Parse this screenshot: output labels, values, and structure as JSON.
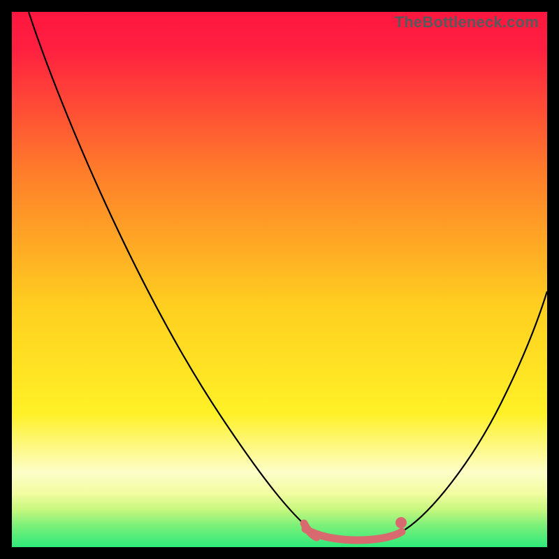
{
  "watermark": "TheBottleneck.com",
  "colors": {
    "red": "#ff163f",
    "orange": "#ff8f1a",
    "yellow": "#ffe821",
    "paleyellow": "#fdfec8",
    "green": "#2eea7a",
    "curve": "#000000",
    "marker_stroke": "#d86a6f",
    "marker_fill": "#d86a6f",
    "highlight_line": "#d86a6f"
  },
  "chart_data": {
    "type": "line",
    "title": "",
    "xlabel": "",
    "ylabel": "",
    "xlim": [
      0,
      100
    ],
    "ylim": [
      0,
      100
    ],
    "series": [
      {
        "name": "bottleneck-curve-left",
        "x": [
          3,
          10,
          20,
          30,
          40,
          50,
          55,
          58
        ],
        "values": [
          100,
          85,
          66,
          46,
          27,
          8,
          2,
          0
        ]
      },
      {
        "name": "bottleneck-curve-right",
        "x": [
          72,
          76,
          82,
          88,
          94,
          100
        ],
        "values": [
          0,
          2,
          10,
          22,
          36,
          52
        ]
      }
    ],
    "flat_region": {
      "x_start": 55,
      "x_end": 72,
      "value": 0
    },
    "marker": {
      "x": 72,
      "value": 0
    }
  }
}
